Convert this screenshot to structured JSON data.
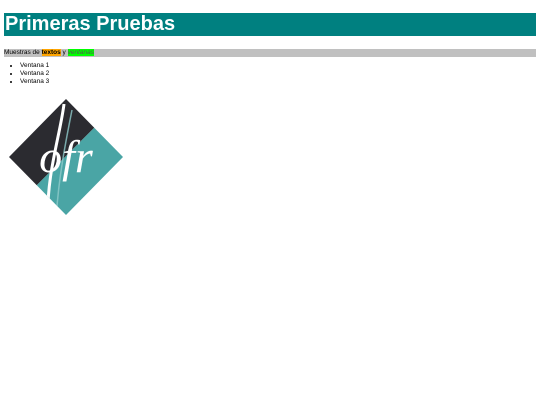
{
  "header": {
    "title": "Primeras Pruebas"
  },
  "subtitle": {
    "prefix": "Muestras de ",
    "highlight1": "textos",
    "middle": " y ",
    "highlight2": "ventanas"
  },
  "list": {
    "items": [
      "Ventana 1",
      "Ventana 2",
      "Ventana 3"
    ]
  },
  "logo": {
    "text": "ofr",
    "icon": "ofr-logo-icon"
  },
  "colors": {
    "header_bg": "#008080",
    "bar_bg": "#c0c0c0",
    "textos_bg": "#ffa500",
    "ventanas_bg": "#00ff00",
    "logo_dark": "#2b2b30",
    "logo_teal": "#4aa5a5"
  }
}
